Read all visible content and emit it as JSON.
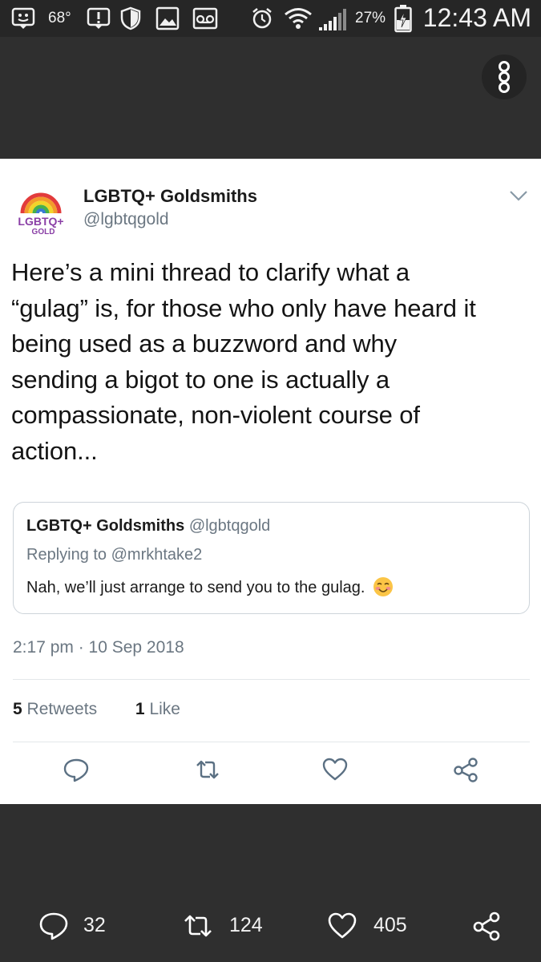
{
  "status_bar": {
    "temperature": "68°",
    "battery_percent": "27%",
    "time": "12:43 AM",
    "icons": [
      "notification-face-icon",
      "alert-icon",
      "shield-icon",
      "image-icon",
      "voicemail-icon",
      "alarm-icon",
      "wifi-icon",
      "signal-icon",
      "battery-charging-icon"
    ]
  },
  "overflow_menu": {
    "icon": "vertical-dots-icon"
  },
  "tweet": {
    "author_name": "LGBTQ+ Goldsmiths",
    "author_handle": "@lgbtqgold",
    "avatar_text_top": "LGBTQ+",
    "avatar_text_bottom": "GOLD",
    "text_lines": [
      "Here’s a mini thread to clarify what a",
      "“gulag” is, for those who only have heard it",
      "being used as a buzzword and why",
      "sending a bigot to one is actually a",
      "compassionate, non-violent course of",
      "action..."
    ],
    "quoted": {
      "author_name": "LGBTQ+ Goldsmiths",
      "author_handle": "@lgbtqgold",
      "replying_to": "Replying to @mrkhtake2",
      "text": "Nah, we’ll just arrange to send you to the gulag."
    },
    "timestamp": "2:17 pm · 10 Sep 2018",
    "retweets_count": "5",
    "retweets_label": "Retweets",
    "likes_count": "1",
    "likes_label": "Like"
  },
  "bottom_bar": {
    "replies": "32",
    "retweets": "124",
    "likes": "405"
  },
  "colors": {
    "card_bg": "#ffffff",
    "dark_bg": "#2f2f2f",
    "secondary_text": "#6b7782",
    "icon_blue_gray": "#5b7083"
  }
}
